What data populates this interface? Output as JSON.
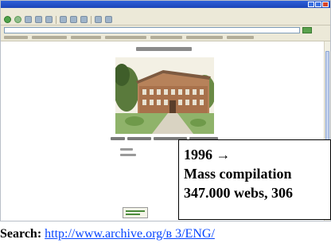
{
  "browser": {
    "title": "",
    "menu": [
      "",
      "",
      "",
      "",
      "",
      ""
    ],
    "address": ""
  },
  "callout": {
    "line1": "1996 →",
    "line2": "Mass compilation",
    "line3": "347.000 webs, 306"
  },
  "source": {
    "label": "Search:",
    "link": "http://www.archive.org/в 3/ENG/"
  },
  "colors": {
    "titlebar": "#1f4fc8",
    "chrome": "#ece9d8",
    "link": "#0645ff"
  },
  "icons": [
    "back-icon",
    "forward-icon",
    "stop-icon",
    "refresh-icon",
    "home-icon",
    "search-icon",
    "favorites-icon",
    "history-icon",
    "mail-icon",
    "print-icon",
    "go-icon"
  ]
}
